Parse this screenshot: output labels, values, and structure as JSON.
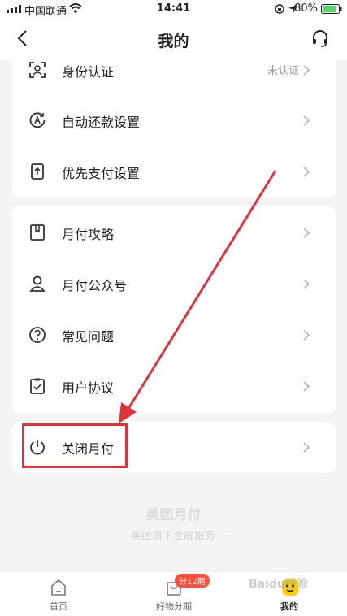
{
  "status_bar": {
    "carrier": "中国联通",
    "time": "14:41",
    "battery_pct": "80%"
  },
  "nav": {
    "title": "我的"
  },
  "section1": {
    "items": [
      {
        "label": "身份认证",
        "status": "未认证"
      },
      {
        "label": "自动还款设置"
      },
      {
        "label": "优先支付设置"
      }
    ]
  },
  "section2": {
    "items": [
      {
        "label": "月付攻略"
      },
      {
        "label": "月付公众号"
      },
      {
        "label": "常见问题"
      },
      {
        "label": "用户协议"
      }
    ]
  },
  "section3": {
    "items": [
      {
        "label": "关闭月付"
      }
    ]
  },
  "footer": {
    "brand": "美团月付",
    "tagline": "— 美团旗下金融服务 —"
  },
  "tabs": {
    "home": "首页",
    "goods": "好物分期",
    "goods_badge": "分12期",
    "mine": "我的"
  },
  "watermark": "Baidu经验",
  "colors": {
    "accent_yellow": "#ffd000",
    "annotation_red": "#e3333a",
    "badge_red": "#ff4f3b"
  }
}
